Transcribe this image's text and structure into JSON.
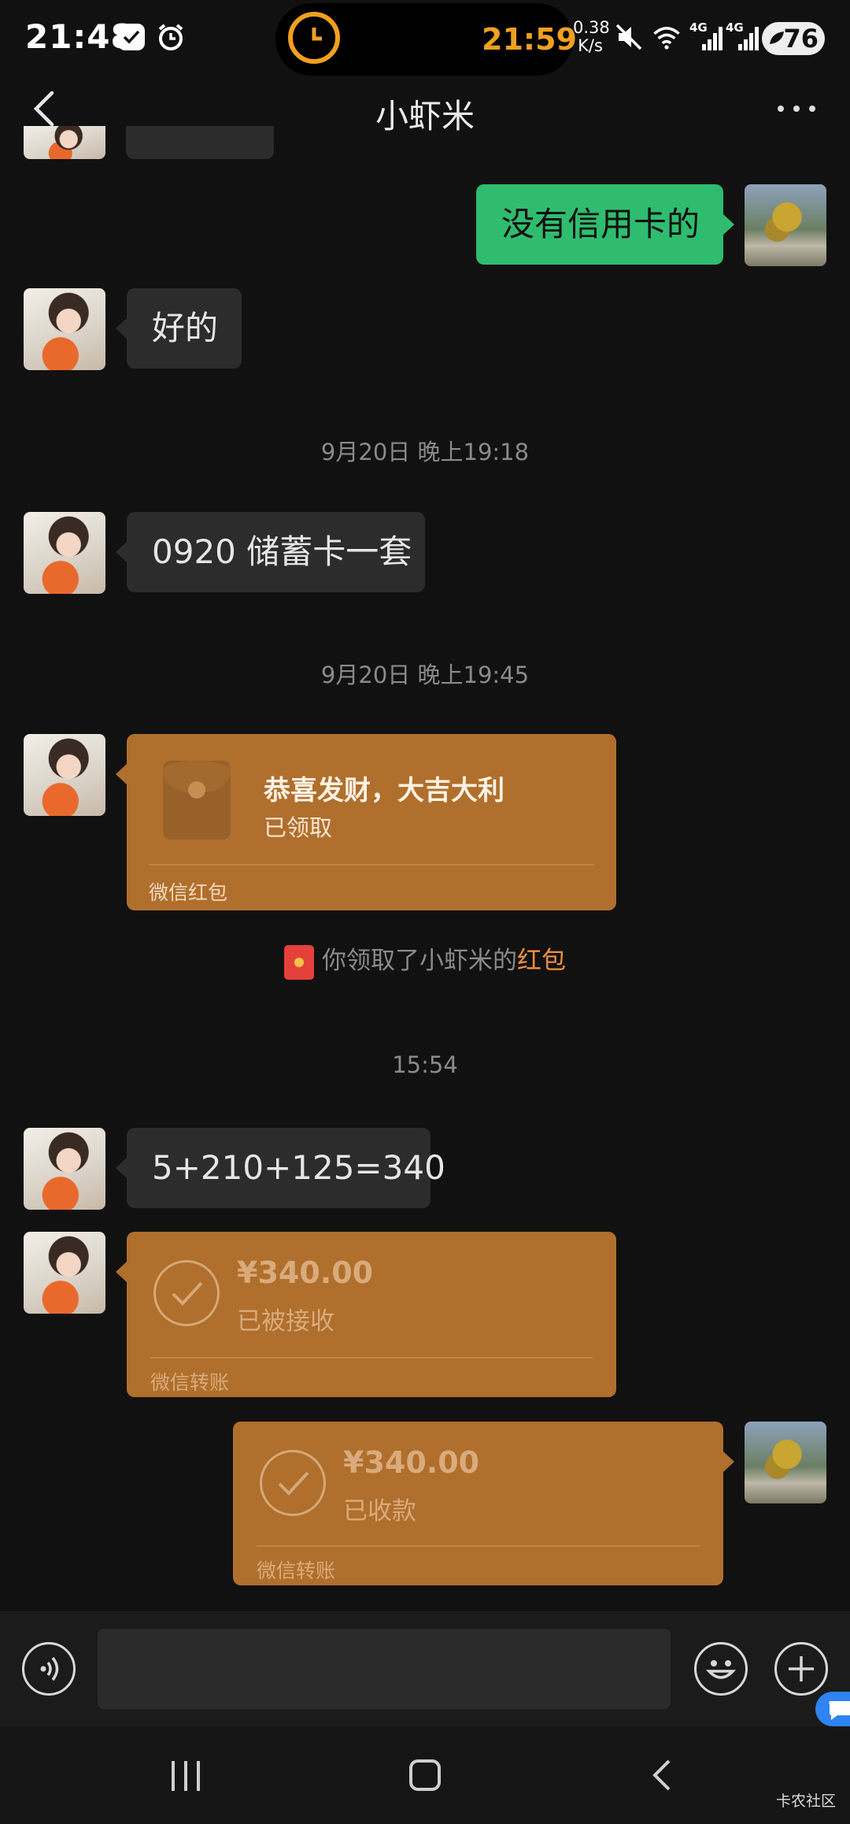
{
  "status_bar": {
    "time": "21:48",
    "island_time": "21:59",
    "net_speed_value": "0.38",
    "net_speed_unit": "K/s",
    "battery": "76",
    "signal_1": "4G",
    "signal_2": "4G"
  },
  "header": {
    "title": "小虾米"
  },
  "messages": {
    "m1_text": "没有信用卡的",
    "m2_text": "好的",
    "ts1": "9月20日 晚上19:18",
    "m3_text": "0920 储蓄卡一套",
    "ts2": "9月20日 晚上19:45",
    "red_packet": {
      "title": "恭喜发财，大吉大利",
      "status": "已领取",
      "footer": "微信红包"
    },
    "system_note": {
      "prefix": "你领取了小虾米的",
      "link": "红包"
    },
    "ts3": "15:54",
    "m5_text": "5+210+125=340",
    "transfer_received": {
      "amount": "¥340.00",
      "status": "已被接收",
      "footer": "微信转账"
    },
    "transfer_accepted": {
      "amount": "¥340.00",
      "status": "已收款",
      "footer": "微信转账"
    }
  },
  "input_bar": {
    "placeholder": ""
  },
  "watermark": "卡农社区",
  "icons": {
    "voice": "voice-icon",
    "emoji": "emoji-icon",
    "plus": "plus-icon",
    "back": "chevron-left-icon",
    "more": "more-dots-icon"
  },
  "colors": {
    "background": "#111111",
    "bubble_self": "#2fbc6f",
    "bubble_other": "#2c2c2c",
    "card": "#b06f2c",
    "link": "#f0913f"
  }
}
